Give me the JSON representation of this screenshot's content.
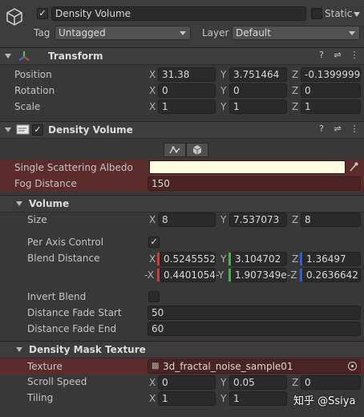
{
  "header": {
    "object_name": "Density Volume",
    "active": true,
    "static_label": "Static",
    "tag_label": "Tag",
    "tag_value": "Untagged",
    "layer_label": "Layer",
    "layer_value": "Default"
  },
  "transform": {
    "title": "Transform",
    "position_label": "Position",
    "position": {
      "x": "31.38",
      "y": "3.751464",
      "z": "-0.1399999"
    },
    "rotation_label": "Rotation",
    "rotation": {
      "x": "0",
      "y": "0",
      "z": "0"
    },
    "scale_label": "Scale",
    "scale": {
      "x": "1",
      "y": "1",
      "z": "1"
    }
  },
  "axes": {
    "x": "X",
    "y": "Y",
    "z": "Z",
    "nx": "-X",
    "ny": "-Y",
    "nz": "-Z"
  },
  "density_volume": {
    "title": "Density Volume",
    "enabled": true,
    "single_scattering_albedo_label": "Single Scattering Albedo",
    "albedo_color": "#fffde0",
    "fog_distance_label": "Fog Distance",
    "fog_distance": "150",
    "volume": {
      "title": "Volume",
      "size_label": "Size",
      "size": {
        "x": "8",
        "y": "7.537073",
        "z": "8"
      },
      "per_axis_control_label": "Per Axis Control",
      "per_axis_control": true,
      "blend_distance_label": "Blend Distance",
      "blend_pos": {
        "x": "0.5245552",
        "y": "3.104702",
        "z": "1.36497"
      },
      "blend_neg": {
        "x": "0.4401054",
        "y": "1.907349e-",
        "z": "0.2636642"
      },
      "invert_blend_label": "Invert Blend",
      "invert_blend": false,
      "distance_fade_start_label": "Distance Fade Start",
      "distance_fade_start": "50",
      "distance_fade_end_label": "Distance Fade End",
      "distance_fade_end": "60"
    },
    "mask": {
      "title": "Density Mask Texture",
      "texture_label": "Texture",
      "texture_value": "3d_fractal_noise_sample01",
      "scroll_speed_label": "Scroll Speed",
      "scroll_speed": {
        "x": "0",
        "y": "0.05",
        "z": "0"
      },
      "tiling_label": "Tiling",
      "tiling": {
        "x": "1",
        "y": "1"
      }
    }
  },
  "watermark": "知乎 @Ssiya",
  "colors": {
    "highlight_row": "#5c2c2c",
    "x_axis": "#d13b3b",
    "y_axis": "#4caf50",
    "z_axis": "#2f5fd0"
  }
}
